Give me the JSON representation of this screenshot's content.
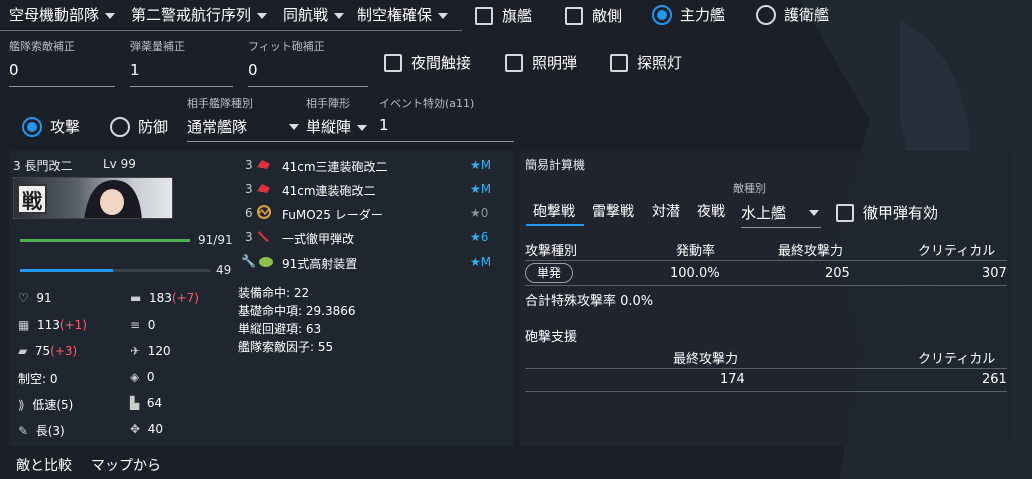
{
  "top": {
    "selects": [
      "空母機動部隊",
      "第二警戒航行序列",
      "同航戦",
      "制空権確保"
    ],
    "checks": [
      {
        "label": "旗艦",
        "checked": false
      },
      {
        "label": "敵側",
        "checked": false
      }
    ],
    "radios": [
      {
        "label": "主力艦",
        "checked": true
      },
      {
        "label": "護衛艦",
        "checked": false
      }
    ]
  },
  "fields": [
    {
      "label": "艦隊索敵補正",
      "value": "0"
    },
    {
      "label": "弾薬量補正",
      "value": "1"
    },
    {
      "label": "フィット砲補正",
      "value": "0"
    }
  ],
  "night_checks": [
    "夜間触接",
    "照明弾",
    "探照灯"
  ],
  "attack_mode": {
    "attack": "攻撃",
    "defense": "防御"
  },
  "enemy": {
    "fleet_type_label": "相手艦隊種別",
    "fleet_type": "通常艦隊",
    "formation_label": "相手陣形",
    "formation": "単縦陣",
    "event_label": "イベント特効(a11)",
    "event_value": "1"
  },
  "ship": {
    "name": "3 長門改二",
    "level": "Lv 99",
    "banner_text": "戦",
    "hp": "91/91",
    "hp_ratio": 1.0,
    "fuel": "49",
    "fuel_ratio": 0.49,
    "stats_left": [
      {
        "icon": "heart-icon",
        "value": "91",
        "bonus": ""
      },
      {
        "icon": "firepower-icon",
        "value": "113",
        "bonus": "(+1)"
      },
      {
        "icon": "armor-icon",
        "value": "75",
        "bonus": "(+3)"
      },
      {
        "icon": "",
        "value": "制空: 0",
        "bonus": ""
      },
      {
        "icon": "speed-icon",
        "value": "低速(5)",
        "bonus": ""
      },
      {
        "icon": "range-icon",
        "value": "長(3)",
        "bonus": ""
      }
    ],
    "stats_right": [
      {
        "icon": "gun-icon",
        "value": "183",
        "bonus": "(+7)"
      },
      {
        "icon": "torpedo-icon",
        "value": "0",
        "bonus": ""
      },
      {
        "icon": "aa-icon",
        "value": "120",
        "bonus": ""
      },
      {
        "icon": "asw-icon",
        "value": "0",
        "bonus": ""
      },
      {
        "icon": "los-icon",
        "value": "64",
        "bonus": ""
      },
      {
        "icon": "luck-icon",
        "value": "40",
        "bonus": ""
      }
    ]
  },
  "equipment": [
    {
      "slot": "3",
      "icon": "main-gun-icon",
      "color": "#d8343a",
      "name": "41cm三連装砲改二",
      "prof": "★M",
      "grey": false
    },
    {
      "slot": "3",
      "icon": "main-gun-icon",
      "color": "#d8343a",
      "name": "41cm連装砲改二",
      "prof": "★M",
      "grey": false
    },
    {
      "slot": "6",
      "icon": "radar-icon",
      "color": "#e0a23a",
      "name": "FuMO25 レーダー",
      "prof": "★0",
      "grey": true
    },
    {
      "slot": "3",
      "icon": "ap-shell-icon",
      "color": "#d8343a",
      "name": "一式徹甲弾改",
      "prof": "★6",
      "grey": false
    },
    {
      "slot": "",
      "icon": "aa-device-icon",
      "color": "#8bc34a",
      "name": "91式高射装置",
      "prof": "★M",
      "grey": false
    }
  ],
  "accuracy": [
    "装備命中: 22",
    "基礎命中項: 29.3866",
    "単縦回避項: 63",
    "艦隊索敵因子: 55"
  ],
  "bottom_tabs": [
    "敵と比較",
    "マップから"
  ],
  "calc": {
    "title": "簡易計算機",
    "tabs": [
      "砲撃戦",
      "雷撃戦",
      "対潜",
      "夜戦"
    ],
    "enemy_type_label": "敵種別",
    "enemy_type": "水上艦",
    "ap_check": "徹甲弾有効",
    "headers": [
      "攻撃種別",
      "発動率",
      "最終攻撃力",
      "クリティカル"
    ],
    "row": {
      "type": "単発",
      "rate": "100.0%",
      "power": "205",
      "crit": "307"
    },
    "special_rate": "合計特殊攻撃率 0.0%",
    "support_title": "砲撃支援",
    "support_headers": [
      "最終攻撃力",
      "クリティカル"
    ],
    "support_row": {
      "power": "174",
      "crit": "261"
    }
  },
  "colors": {
    "accent": "#2196f3",
    "hp": "#4caf50",
    "fuel": "#2196f3",
    "bonus": "#ff5a6e",
    "prof": "#29b6f6"
  }
}
